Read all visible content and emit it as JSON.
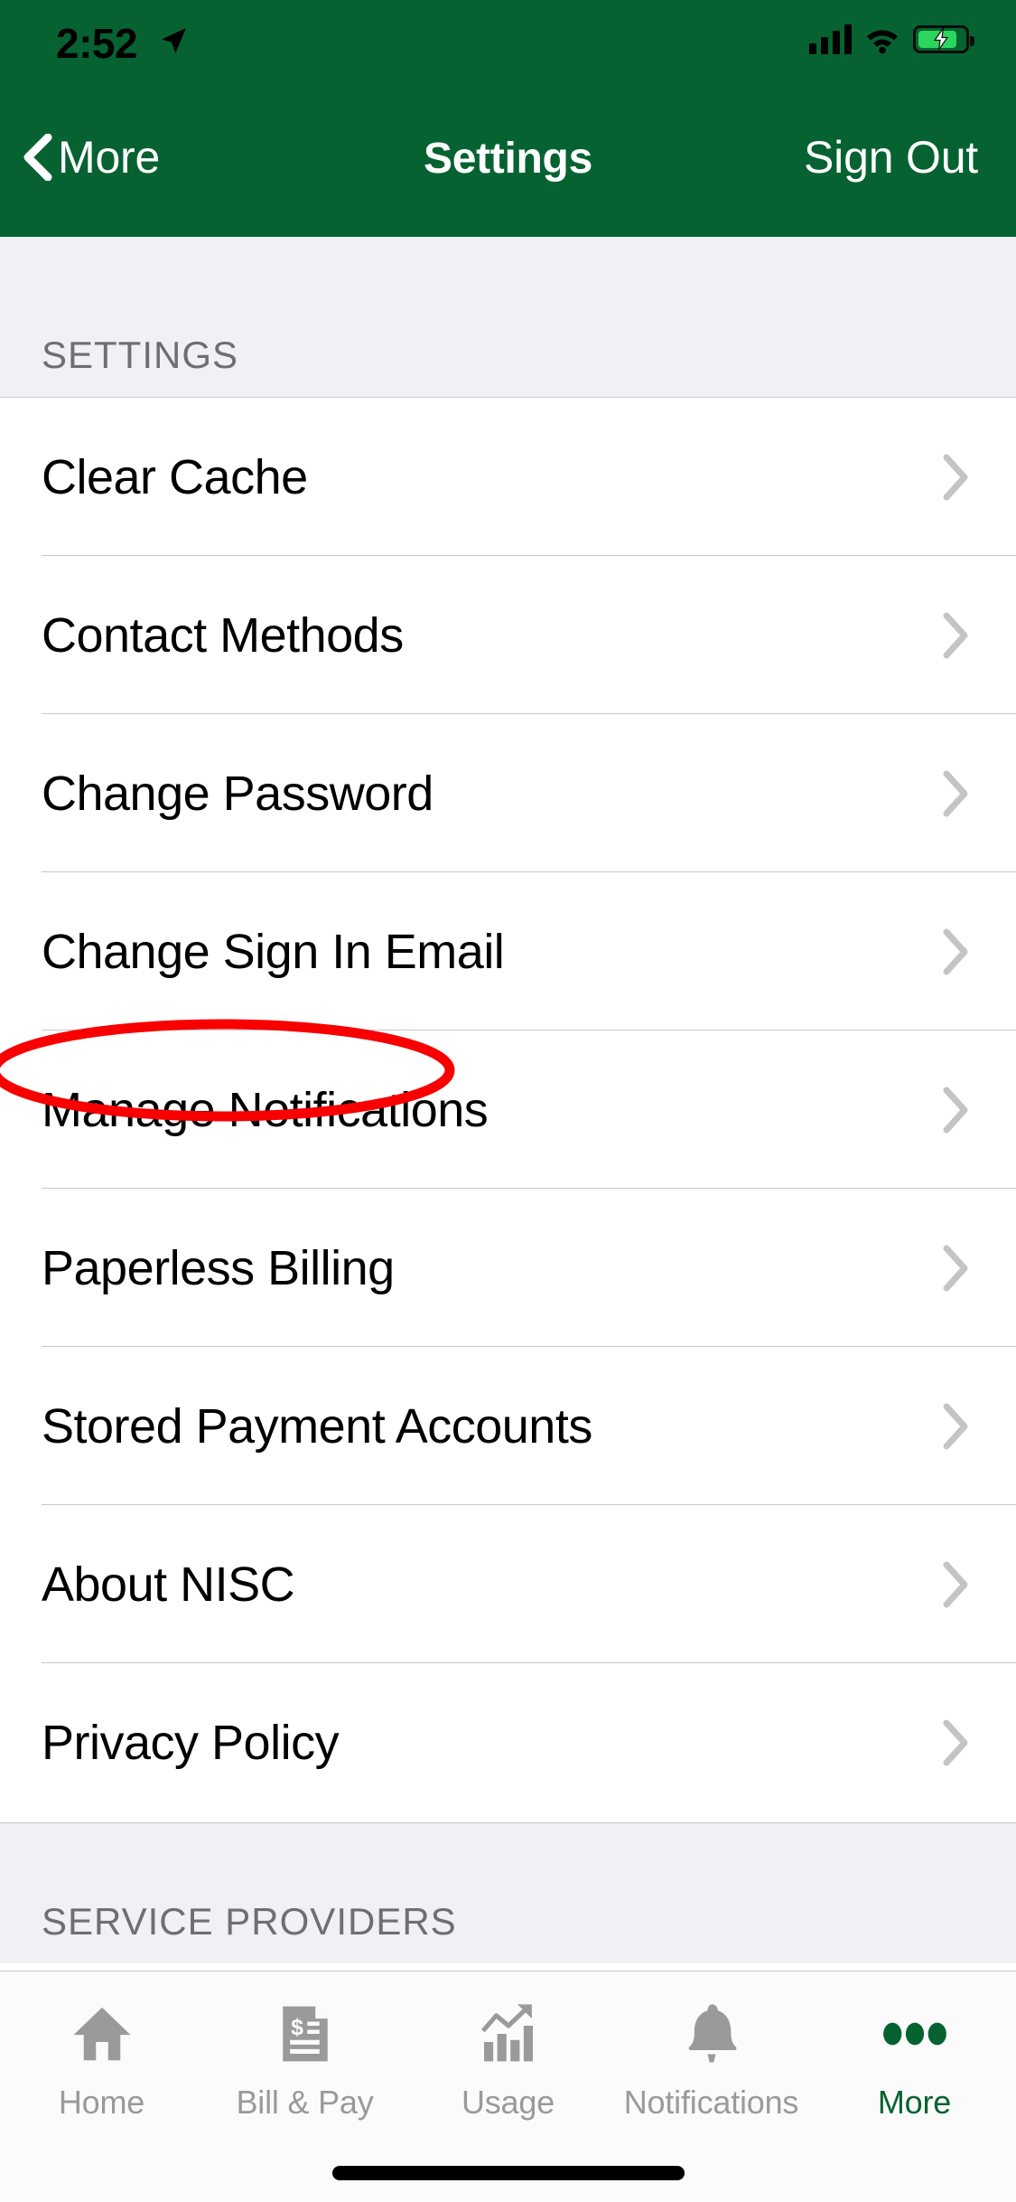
{
  "status_bar": {
    "time": "2:52",
    "location_icon": "location-arrow-icon",
    "signal_icon": "cellular-signal-icon",
    "wifi_icon": "wifi-icon",
    "battery_icon": "battery-charging-icon"
  },
  "nav": {
    "back_icon": "chevron-left-icon",
    "back_label": "More",
    "title": "Settings",
    "action_label": "Sign Out"
  },
  "sections": [
    {
      "header": "SETTINGS",
      "rows": [
        {
          "label": "Clear Cache",
          "chevron": "chevron-right-icon"
        },
        {
          "label": "Contact Methods",
          "chevron": "chevron-right-icon"
        },
        {
          "label": "Change Password",
          "chevron": "chevron-right-icon"
        },
        {
          "label": "Change Sign In Email",
          "chevron": "chevron-right-icon"
        },
        {
          "label": "Manage Notifications",
          "chevron": "chevron-right-icon"
        },
        {
          "label": "Paperless Billing",
          "chevron": "chevron-right-icon"
        },
        {
          "label": "Stored Payment Accounts",
          "chevron": "chevron-right-icon"
        },
        {
          "label": "About NISC",
          "chevron": "chevron-right-icon"
        },
        {
          "label": "Privacy Policy",
          "chevron": "chevron-right-icon"
        }
      ]
    },
    {
      "header": "SERVICE PROVIDERS",
      "rows": []
    }
  ],
  "annotation": {
    "shape": "ellipse",
    "color": "#f80000",
    "target_label": "Manage Notifications"
  },
  "tabbar": {
    "items": [
      {
        "label": "Home",
        "icon": "home-icon",
        "active": false
      },
      {
        "label": "Bill & Pay",
        "icon": "bill-document-icon",
        "active": false
      },
      {
        "label": "Usage",
        "icon": "bar-chart-icon",
        "active": false
      },
      {
        "label": "Notifications",
        "icon": "bell-icon",
        "active": false
      },
      {
        "label": "More",
        "icon": "ellipsis-icon",
        "active": true
      }
    ]
  },
  "colors": {
    "header_green": "#066331",
    "accent_green": "#066331",
    "section_bg": "#f1f1f5",
    "separator": "#c8c7cc",
    "inactive_tab": "#9a9a9a",
    "annotation_red": "#f80000"
  },
  "home_indicator": "home-indicator-bar"
}
